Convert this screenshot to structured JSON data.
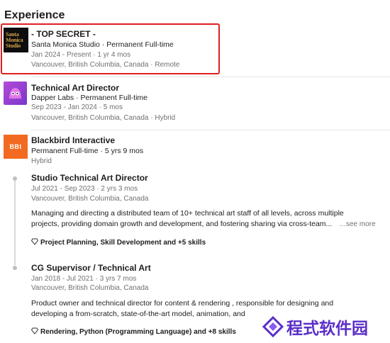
{
  "section": {
    "title": "Experience"
  },
  "logos": {
    "sms_line1": "Santa",
    "sms_line2": "Monica",
    "sms_line3": "Studio",
    "bbi": "BBI"
  },
  "jobs": [
    {
      "title": "- TOP SECRET -",
      "company": "Santa Monica Studio · Permanent Full-time",
      "dates": "Jan 2024 - Present · 1 yr 4 mos",
      "location": "Vancouver, British Columbia, Canada · Remote"
    },
    {
      "title": "Technical Art Director",
      "company": "Dapper Labs · Permanent Full-time",
      "dates": "Sep 2023 - Jan 2024 · 5 mos",
      "location": "Vancouver, British Columbia, Canada · Hybrid"
    }
  ],
  "group": {
    "company": "Blackbird Interactive",
    "type": "Permanent Full-time · 5 yrs 9 mos",
    "mode": "Hybrid",
    "roles": [
      {
        "title": "Studio Technical Art Director",
        "dates": "Jul 2021 - Sep 2023 · 2 yrs 3 mos",
        "location": "Vancouver, British Columbia, Canada",
        "desc_line1": "Managing and directing a distributed team of 10+ technical art staff of all levels, across multiple",
        "desc_line2": "projects, providing domain growth and development, and fostering sharing via cross-team...",
        "see_more": "…see more",
        "skills": "Project Planning, Skill Development and +5 skills"
      },
      {
        "title": "CG Supervisor / Technical Art",
        "dates": "Jan 2018 - Jul 2021 · 3 yrs 7 mos",
        "location": "Vancouver, British Columbia, Canada",
        "desc_line1": "Product owner and technical director for content & rendering , responsible for designing and",
        "desc_line2": "developing a from-scratch, state-of-the-art model, animation, and",
        "skills": "Rendering, Python (Programming Language) and +8 skills"
      }
    ]
  },
  "watermark": {
    "text": "程式软件园"
  },
  "colors": {
    "highlight": "#e02020",
    "bbi": "#f26a21",
    "dapper": "#9b45d4",
    "watermark": "#5a2fc8"
  }
}
